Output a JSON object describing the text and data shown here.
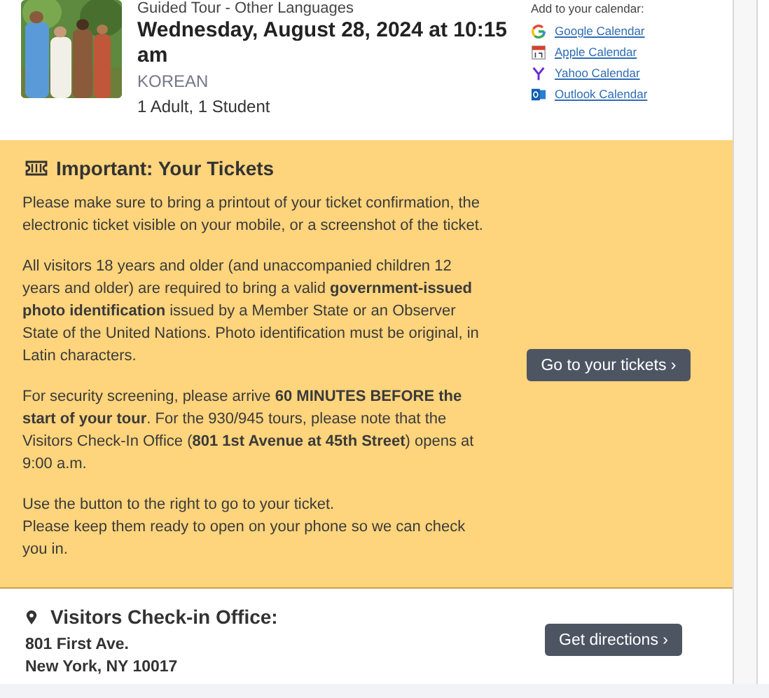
{
  "tour": {
    "category": "Guided Tour - Other Languages",
    "datetime": "Wednesday, August 28, 2024 at 10:15 am",
    "language": "KOREAN",
    "guests": "1 Adult, 1 Student"
  },
  "calendar": {
    "label": "Add to your calendar:",
    "links": [
      {
        "label": "Google Calendar",
        "kind": "google"
      },
      {
        "label": "Apple Calendar",
        "kind": "apple"
      },
      {
        "label": "Yahoo Calendar",
        "kind": "yahoo"
      },
      {
        "label": "Outlook Calendar",
        "kind": "outlook"
      }
    ]
  },
  "tickets_notice": {
    "title": "Important: Your Tickets",
    "paragraphs": [
      [
        "Please make sure to bring a printout of your ticket confirmation, the electronic ticket visible on your mobile, or a screenshot of the ticket."
      ],
      [
        "All visitors 18 years and older (and unaccompanied children 12 years and older) are required to bring a valid **government-issued photo identification** issued by a Member State or an Observer State of the United Nations. Photo identification must be original, in Latin characters."
      ],
      [
        "For security screening, please arrive **60 MINUTES BEFORE the start of your tour**. For the 930/945 tours, please note that the Visitors Check-In Office (**801 1st Avenue at 45th Street**) opens at 9:00 a.m."
      ],
      [
        "Use the button to the right to go to your ticket.",
        "Please keep them ready to open on your phone so we can check you in."
      ]
    ],
    "button": "Go to your tickets ›"
  },
  "check_in": {
    "title": "Visitors Check-in Office:",
    "address_lines": [
      "801 First Ave.",
      "New York, NY 10017"
    ],
    "button": "Get directions ›"
  }
}
